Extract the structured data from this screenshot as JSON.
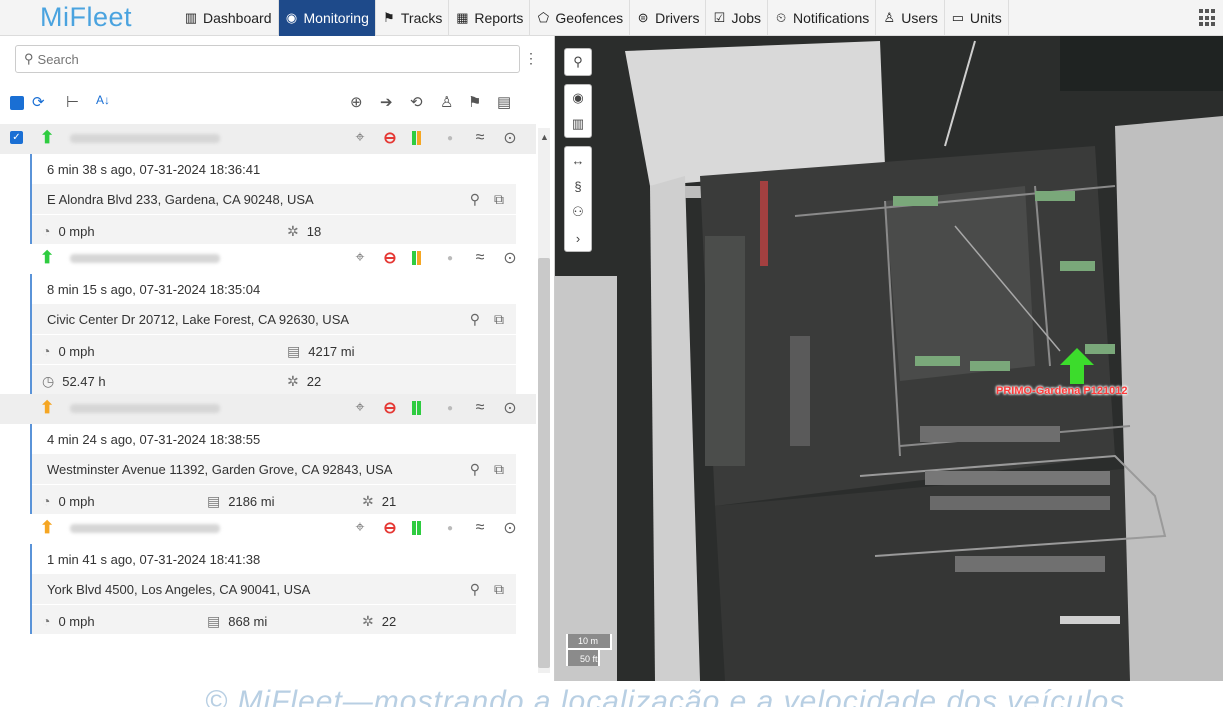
{
  "app": {
    "logo": "MiFleet"
  },
  "nav": [
    {
      "label": "Dashboard",
      "icon": "bar-chart-icon",
      "glyph": "▥"
    },
    {
      "label": "Monitoring",
      "icon": "compass-icon",
      "glyph": "◉",
      "active": true
    },
    {
      "label": "Tracks",
      "icon": "flag-icon",
      "glyph": "⚑"
    },
    {
      "label": "Reports",
      "icon": "report-icon",
      "glyph": "▦"
    },
    {
      "label": "Geofences",
      "icon": "geofence-icon",
      "glyph": "⬠"
    },
    {
      "label": "Drivers",
      "icon": "steering-wheel-icon",
      "glyph": "⊜"
    },
    {
      "label": "Jobs",
      "icon": "checklist-icon",
      "glyph": "☑"
    },
    {
      "label": "Notifications",
      "icon": "bell-clock-icon",
      "glyph": "⏲"
    },
    {
      "label": "Users",
      "icon": "users-icon",
      "glyph": "♙"
    },
    {
      "label": "Units",
      "icon": "truck-icon",
      "glyph": "▭"
    }
  ],
  "search": {
    "placeholder": "Search"
  },
  "units": [
    {
      "arrow_color": "#2ecc40",
      "signal_colors": [
        "#2ecc40",
        "#f5a623"
      ],
      "selected": true,
      "time": "6 min 38 s ago, 07-31-2024 18:36:41",
      "address": "E Alondra Blvd 233, Gardena, CA 90248, USA",
      "speed": "0 mph",
      "mileage": "",
      "satellites": "18",
      "hours": ""
    },
    {
      "arrow_color": "#2ecc40",
      "signal_colors": [
        "#2ecc40",
        "#f5a623"
      ],
      "selected": false,
      "time": "8 min 15 s ago, 07-31-2024 18:35:04",
      "address": "Civic Center Dr 20712, Lake Forest, CA 92630, USA",
      "speed": "0 mph",
      "mileage": "4217 mi",
      "satellites": "22",
      "hours": "52.47 h"
    },
    {
      "arrow_color": "#f5a623",
      "signal_colors": [
        "#2ecc40",
        "#2ecc40"
      ],
      "selected": false,
      "time": "4 min 24 s ago, 07-31-2024 18:38:55",
      "address": "Westminster Avenue 11392, Garden Grove, CA 92843, USA",
      "speed": "0 mph",
      "mileage": "2186 mi",
      "satellites": "21",
      "hours": ""
    },
    {
      "arrow_color": "#f5a623",
      "signal_colors": [
        "#2ecc40",
        "#2ecc40"
      ],
      "selected": false,
      "time": "1 min 41 s ago, 07-31-2024 18:41:38",
      "address": "York Blvd 4500, Los Angeles, CA 90041, USA",
      "speed": "0 mph",
      "mileage": "868 mi",
      "satellites": "22",
      "hours": ""
    }
  ],
  "map": {
    "marker_label": "PRIMO-Gardena P121012",
    "scale_metric": "10 m",
    "scale_imperial": "50 ft"
  },
  "caption": "© MiFleet—mostrando a localização e a velocidade dos veículos"
}
